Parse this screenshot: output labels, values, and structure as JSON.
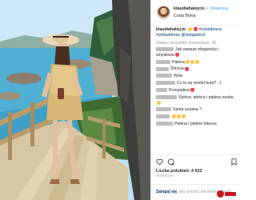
{
  "header": {
    "username": "klaudiahalejcio",
    "separator": "•",
    "follow_label": "Obserwuj",
    "location": "Costa Brava"
  },
  "caption": {
    "username": "klaudiahalejcio",
    "hashtags": "#costabrava #yellowdress @violapiekut"
  },
  "load_more_label": "Zobacz wszystkie komentarze: 38",
  "comments": [
    {
      "text": "Jak zawsze elegancka i zmysłowa",
      "emoji": [
        "heart"
      ]
    },
    {
      "text": "Piękna",
      "emoji": [
        "smile",
        "smile",
        "smile"
      ]
    },
    {
      "text": "Śliczna",
      "emoji": [
        "heart"
      ]
    },
    {
      "text": "Wow",
      "emoji": []
    },
    {
      "text": "Co to za model buta? :-)",
      "emoji": []
    },
    {
      "text": "Przepiękna",
      "emoji": [
        "heart"
      ]
    },
    {
      "text": "Słońce, słońce i piękna osoba",
      "emoji": [
        "smile"
      ]
    },
    {
      "text": "Santa suzana ?",
      "emoji": []
    },
    {
      "text": "",
      "emoji": [
        "smile",
        "smile",
        "smile"
      ]
    },
    {
      "text": "Piekna i piekne miesce",
      "emoji": []
    }
  ],
  "likes": {
    "label": "Liczba polubień:",
    "count": "4 923"
  },
  "footer": {
    "login_label": "Zaloguj się",
    "rest": ", aby polubić lub skomentować."
  },
  "colors": {
    "link_blue": "#3897f0",
    "hashtag": "#003569",
    "sea": "#4aa7c9",
    "dress": "#d9b776"
  },
  "icons": [
    "heart-icon",
    "comment-icon",
    "bookmark-icon"
  ]
}
